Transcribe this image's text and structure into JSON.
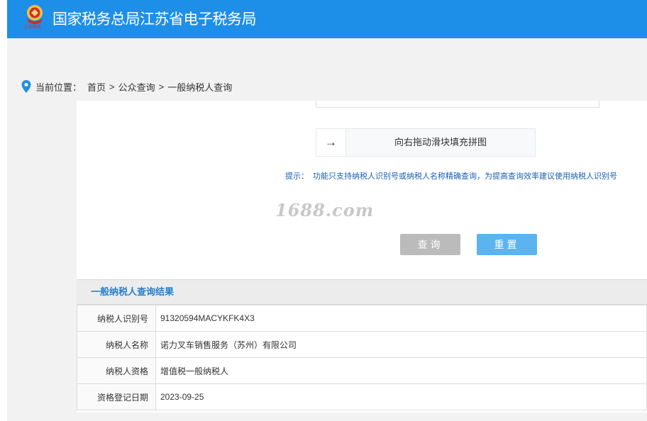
{
  "header": {
    "emblem_caption": "江苏税务",
    "title": "国家税务总局江苏省电子税务局"
  },
  "breadcrumb": {
    "label": "当前位置：",
    "items": [
      "首页",
      "公众查询",
      "一般纳税人查询"
    ],
    "separator": ">"
  },
  "slider": {
    "handle_arrow": "→",
    "text": "向右拖动滑块填充拼图"
  },
  "tip": {
    "label": "提示：",
    "text": "功能只支持纳税人识别号或纳税人名称精确查询，为提高查询效率建议使用纳税人识别号"
  },
  "watermark": "1688.com",
  "buttons": {
    "query": "查询",
    "reset": "重置"
  },
  "result": {
    "title": "一般纳税人查询结果",
    "rows": [
      {
        "key": "纳税人识别号",
        "value": "91320594MACYKFK4X3"
      },
      {
        "key": "纳税人名称",
        "value": "诺力叉车销售服务（苏州）有限公司"
      },
      {
        "key": "纳税人资格",
        "value": "增值税一般纳税人"
      },
      {
        "key": "资格登记日期",
        "value": "2023-09-25"
      }
    ]
  },
  "colors": {
    "header_bg": "#1e8fe8",
    "tip_text": "#1a5fb4",
    "result_title": "#2a7fc8",
    "query_button": "#bbbbbb",
    "reset_button": "#5bb4f0"
  }
}
